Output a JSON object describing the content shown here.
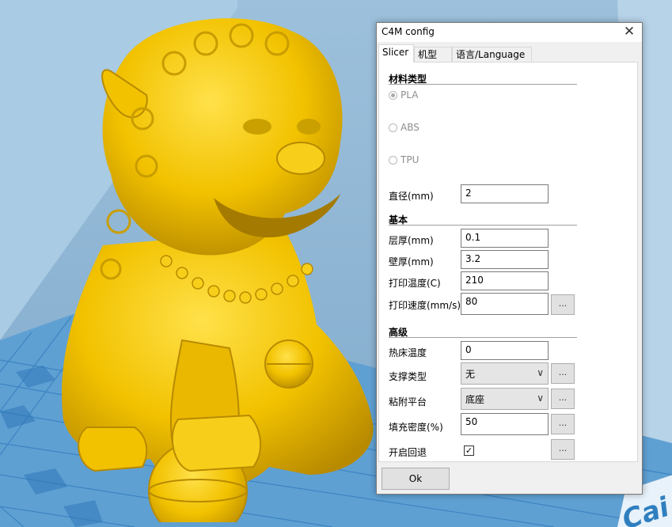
{
  "dialog": {
    "title": "C4M config",
    "close_glyph": "✕",
    "tabs": [
      {
        "label": "Slicer",
        "active": true
      },
      {
        "label": "机型",
        "active": false
      },
      {
        "label": "语言/Language",
        "active": false
      }
    ],
    "sections": {
      "material": "材料类型",
      "basic": "基本",
      "advanced": "高级"
    },
    "materials": [
      {
        "label": "PLA",
        "checked": true
      },
      {
        "label": "ABS",
        "checked": false
      },
      {
        "label": "TPU",
        "checked": false
      }
    ],
    "diameter": {
      "label": "直径(mm)",
      "value": "2"
    },
    "basic_fields": [
      {
        "label": "层厚(mm)",
        "value": "0.1"
      },
      {
        "label": "壁厚(mm)",
        "value": "3.2"
      },
      {
        "label": "打印温度(C)",
        "value": "210"
      },
      {
        "label": "打印速度(mm/s)",
        "value": "80"
      }
    ],
    "advanced_fields": {
      "bed_temp": {
        "label": "热床温度",
        "value": "0"
      },
      "support": {
        "label": "支撑类型",
        "value": "无"
      },
      "adhesion": {
        "label": "粘附平台",
        "value": "底座"
      },
      "infill": {
        "label": "填充密度(%)",
        "value": "50"
      },
      "retraction": {
        "label": "开启回退",
        "checked": true
      }
    },
    "ellipsis": "...",
    "ok_label": "Ok"
  },
  "logo": {
    "text": "Cai"
  },
  "colors": {
    "model": "#f2c200",
    "floor": "#5a9bd0",
    "grid": "#3e86c4",
    "background": "#8fb6d4"
  }
}
